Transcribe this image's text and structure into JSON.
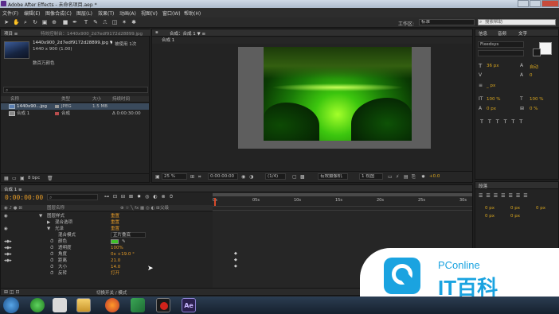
{
  "app": {
    "title": "Adobe After Effects - 未命名项目.aep *"
  },
  "menu": [
    "文件(F)",
    "编辑(E)",
    "图像合成(C)",
    "图层(L)",
    "效果(T)",
    "动画(A)",
    "视图(V)",
    "窗口(W)",
    "帮助(H)"
  ],
  "toolbar": {
    "workspace_label": "工作区:",
    "workspace_value": "标准",
    "search_placeholder": "搜索帮助"
  },
  "project": {
    "tab_label": "项目 ≡",
    "effects_tab_label": "特效控制台：1440x900_2d7edf9172d28899.jpg",
    "file_name": "1440x900_2d7edf9172d28899.jpg ▼",
    "used_label": "被使用 1次",
    "dims": "1440 x 900 (1.00)",
    "bg_label": "数百万颜色",
    "col_name": "名称",
    "col_type": "类型",
    "col_size": "大小",
    "col_duration": "持续时间",
    "items": [
      {
        "name": "1440x90...jpg",
        "type": "JPEG",
        "size": "1.5 MB",
        "duration": ""
      },
      {
        "name": "合成 1",
        "type": "合成",
        "size": "",
        "duration": "Δ 0:00:30:00"
      }
    ],
    "bpc": "8 bpc"
  },
  "comp_viewer": {
    "tab_label": "合成：合成 1 ▼ ≡",
    "sub_tab": "合成 1",
    "zoom": "25 %",
    "timecode": "0:00:00:00",
    "resolution": "(1/4)",
    "camera": "有效摄像机",
    "view": "1 视图",
    "exposure": "+0.0"
  },
  "right_panel": {
    "tabs": [
      "信息",
      "音频",
      "文字"
    ],
    "font": "Fixedsys",
    "size": "36 px",
    "leading": "自动",
    "tracking": "0",
    "stroke": "_ px",
    "scale_v": "100 %",
    "scale_h": "100 %",
    "baseline": "0 px",
    "tsume": "0 %",
    "paragraph_tab": "段落",
    "para_values": [
      "0 px",
      "0 px",
      "0 px",
      "0 px",
      "0 px"
    ]
  },
  "timeline": {
    "tab_label": "合成 1 ≡",
    "timecode": "0:00:00:00",
    "col_layer": "图层名称",
    "col_parent": "父级",
    "ruler": [
      "0s",
      "05s",
      "10s",
      "15s",
      "20s",
      "25s",
      "30s"
    ],
    "rows": [
      {
        "label": "图层样式",
        "value": "重置",
        "indent": 1
      },
      {
        "label": "混合选项",
        "value": "重置",
        "indent": 2
      },
      {
        "label": "光泽",
        "value": "重置",
        "indent": 2
      },
      {
        "label": "混合模式",
        "value": "正片叠底",
        "indent": 3
      },
      {
        "label": "颜色",
        "value": "",
        "indent": 3
      },
      {
        "label": "透明度",
        "value": "100%",
        "indent": 3
      },
      {
        "label": "角度",
        "value": "0x +19.0 °",
        "indent": 3
      },
      {
        "label": "距离",
        "value": "21.0",
        "indent": 3
      },
      {
        "label": "大小",
        "value": "14.0",
        "indent": 3
      },
      {
        "label": "反转",
        "value": "打开",
        "indent": 3
      }
    ],
    "footer_label": "切换开关 / 模式"
  },
  "watermark": {
    "brand": "PConline",
    "product": "IT百科"
  }
}
